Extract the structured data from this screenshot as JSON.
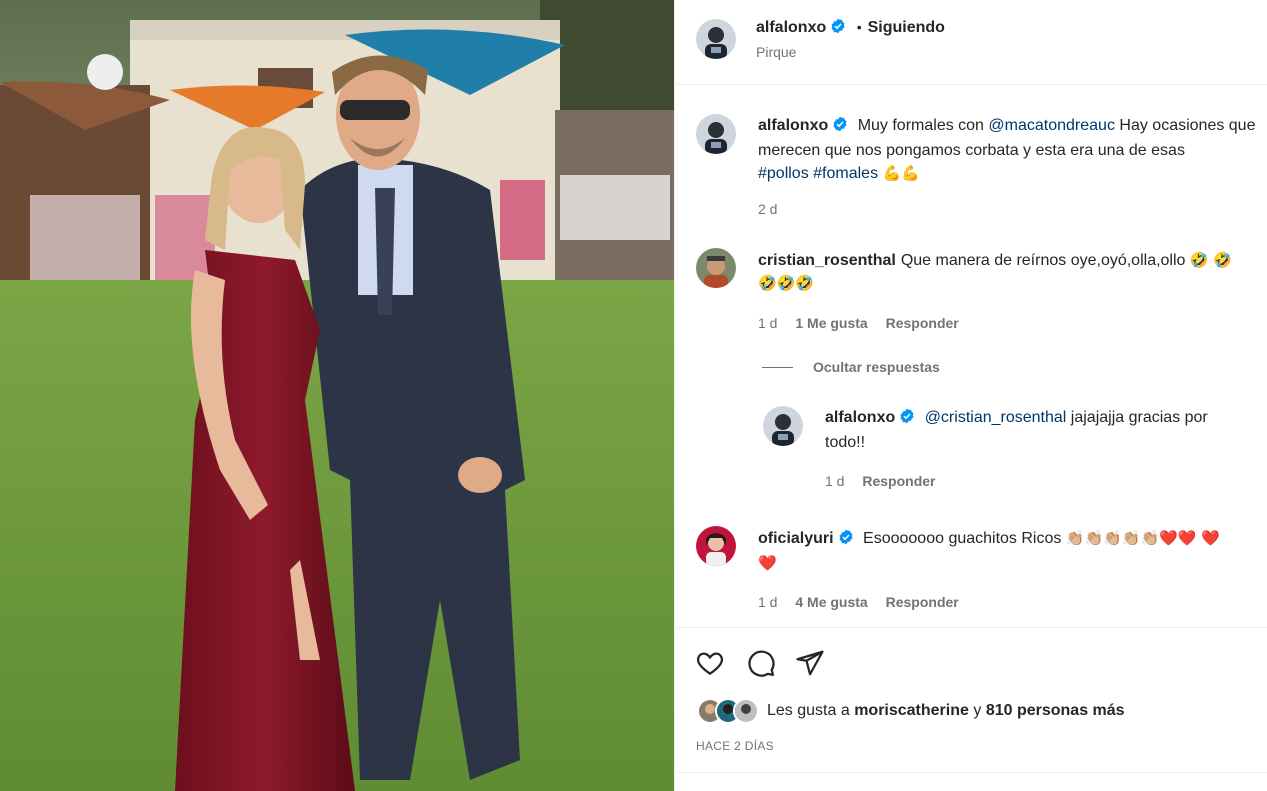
{
  "post": {
    "username": "alfalonxo",
    "separator": "•",
    "follow_status": "Siguiendo",
    "location": "Pirque"
  },
  "caption": {
    "username": "alfalonxo",
    "text_1": "Muy formales con",
    "mention": "@macatondreauc",
    "text_2": "Hay ocasiones que merecen que nos pongamos corbata y esta era una de esas",
    "hashtag_1": "#pollos",
    "hashtag_2": "#fomales",
    "emojis": "💪💪",
    "time": "2 d"
  },
  "comments": [
    {
      "username": "cristian_rosenthal",
      "text": "Que manera de reírnos oye,oyó,olla,ollo",
      "emojis": "🤣 🤣🤣🤣🤣",
      "time": "1 d",
      "likes": "1 Me gusta",
      "reply_label": "Responder",
      "hide_replies": "Ocultar respuestas"
    },
    {
      "username": "alfalonxo",
      "mention": "@cristian_rosenthal",
      "text": "jajajajja gracias por todo!!",
      "time": "1 d",
      "reply_label": "Responder"
    },
    {
      "username": "oficialyuri",
      "text": "Esooooooo guachitos Ricos",
      "emojis": "👏🏼👏🏼👏🏼👏🏼👏🏼❤️❤️ ❤️❤️",
      "time": "1 d",
      "likes": "4 Me gusta",
      "reply_label": "Responder"
    }
  ],
  "footer": {
    "likes_prefix": "Les gusta a",
    "likes_user": "moriscatherine",
    "likes_conj": "y",
    "likes_count": "810 personas más",
    "date": "HACE 2 DÍAS"
  },
  "icons": {
    "like": "heart-icon",
    "comment": "comment-icon",
    "share": "paper-plane-icon",
    "verified": "verified-badge-icon"
  },
  "colors": {
    "link": "#00376b",
    "verified": "#0095f6",
    "muted": "#737373"
  }
}
